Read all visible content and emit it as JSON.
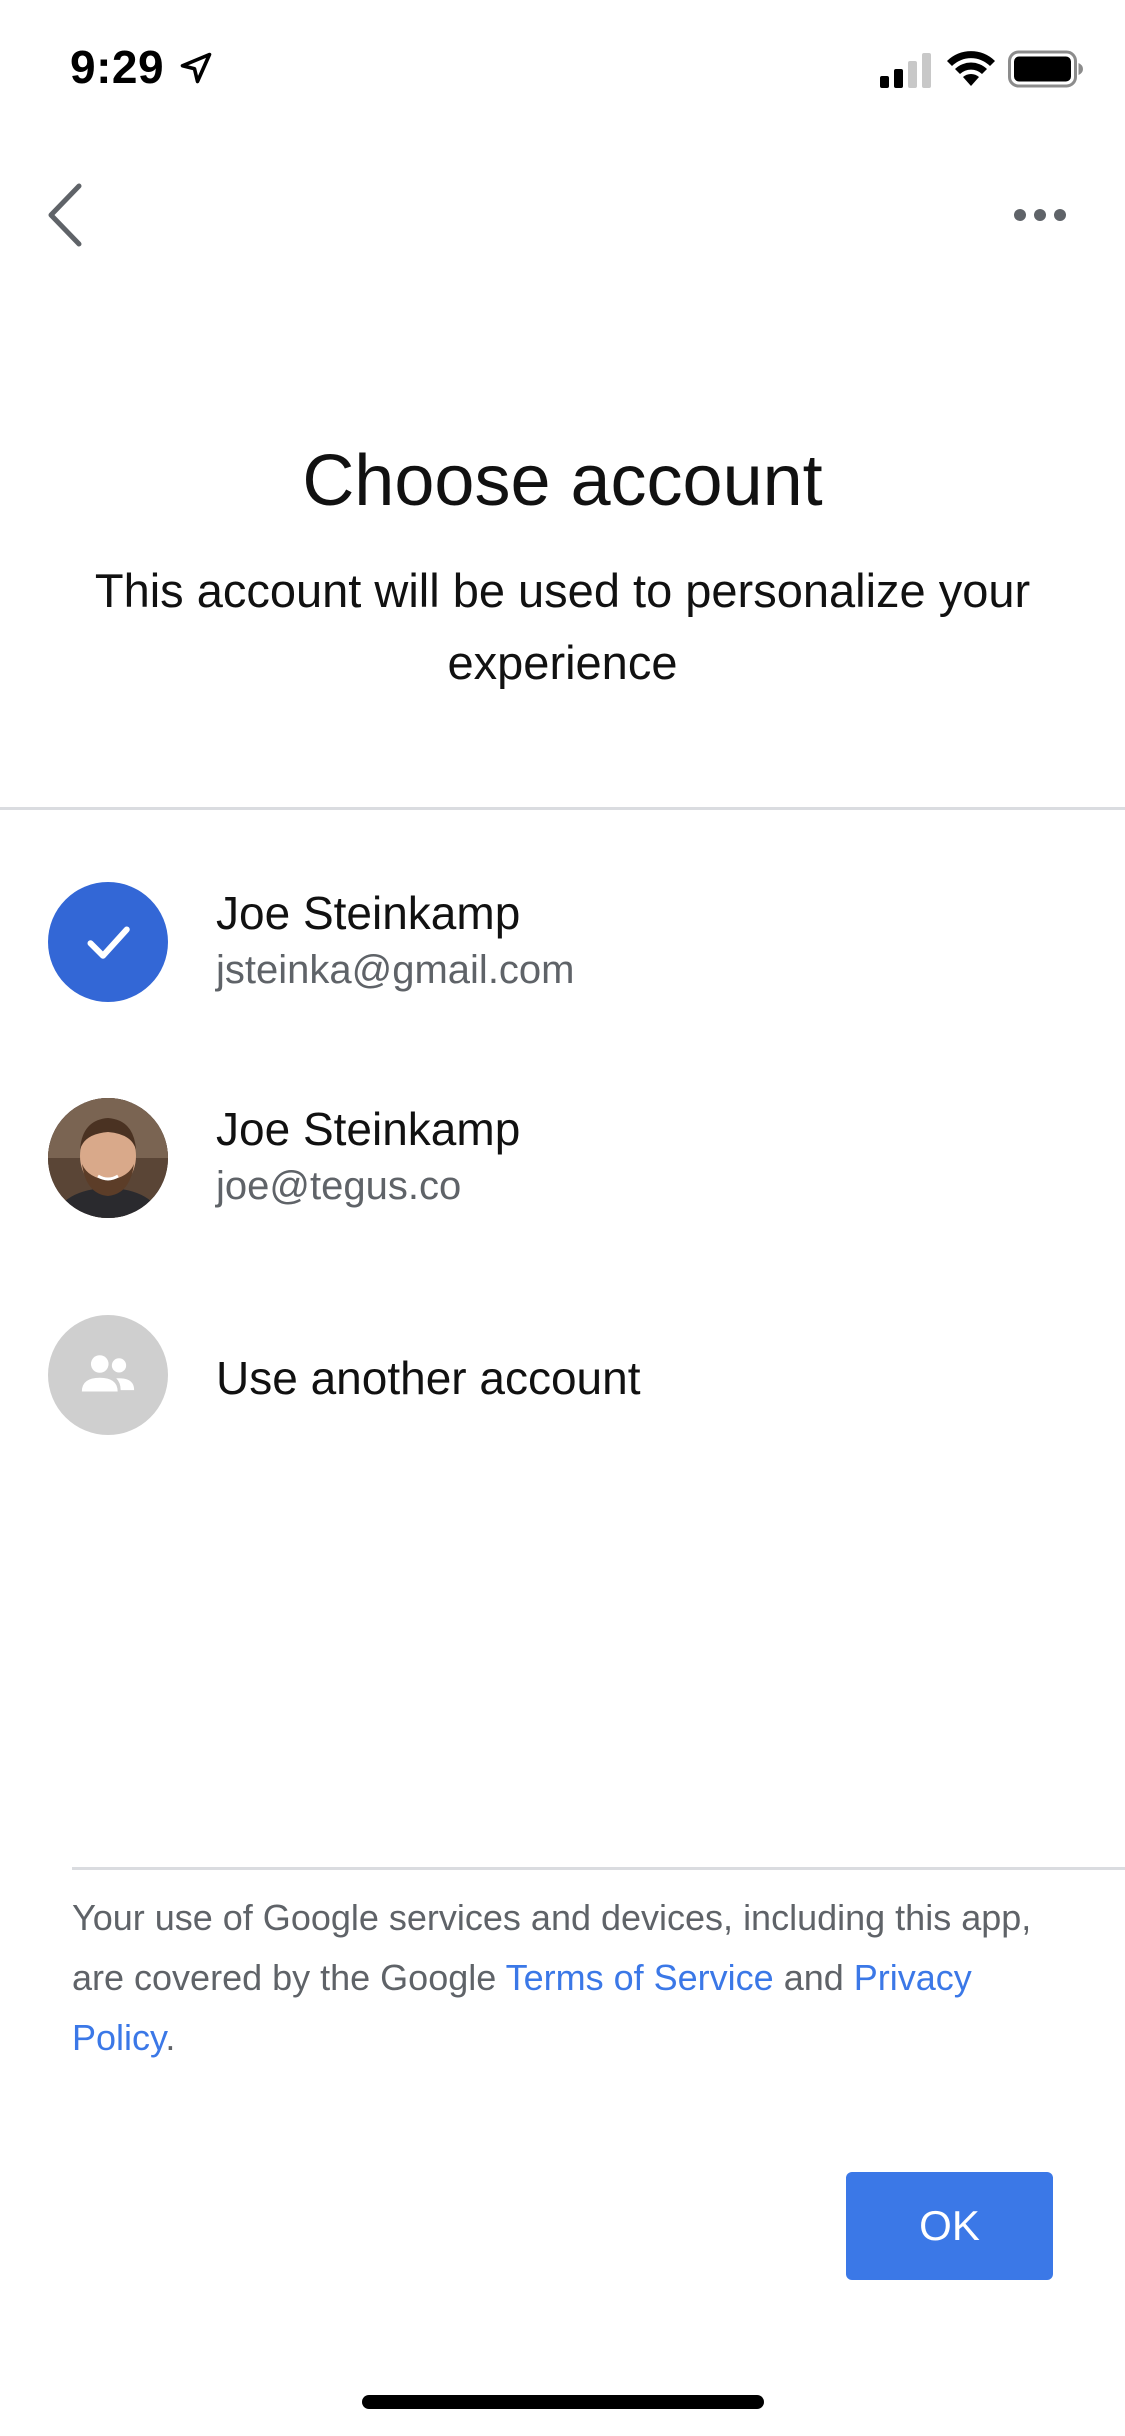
{
  "status_bar": {
    "time": "9:29",
    "icons": [
      "location-arrow-icon",
      "cellular-signal-icon",
      "wifi-icon",
      "battery-icon"
    ]
  },
  "nav": {
    "back_icon": "chevron-left-icon",
    "more_icon": "more-horizontal-icon"
  },
  "header": {
    "title": "Choose account",
    "subtitle": "This account will be used to personalize your experience"
  },
  "accounts": [
    {
      "name": "Joe Steinkamp",
      "email": "jsteinka@gmail.com",
      "avatar": "check-icon",
      "selected": true
    },
    {
      "name": "Joe Steinkamp",
      "email": "joe@tegus.co",
      "avatar": "profile-photo",
      "selected": false
    }
  ],
  "another_account": {
    "label": "Use another account",
    "icon": "people-icon"
  },
  "legal": {
    "text_before": "Your use of Google services and devices, including this app, are covered by the Google ",
    "terms_link": "Terms of Service",
    "text_middle": " and ",
    "privacy_link": "Privacy Policy",
    "text_after": "."
  },
  "ok_button": {
    "label": "OK"
  },
  "colors": {
    "accent": "#3b78e7",
    "selected_avatar": "#3367d6",
    "generic_avatar": "#cfcfcf",
    "divider": "#dadce0",
    "secondary_text": "#5f6368"
  }
}
